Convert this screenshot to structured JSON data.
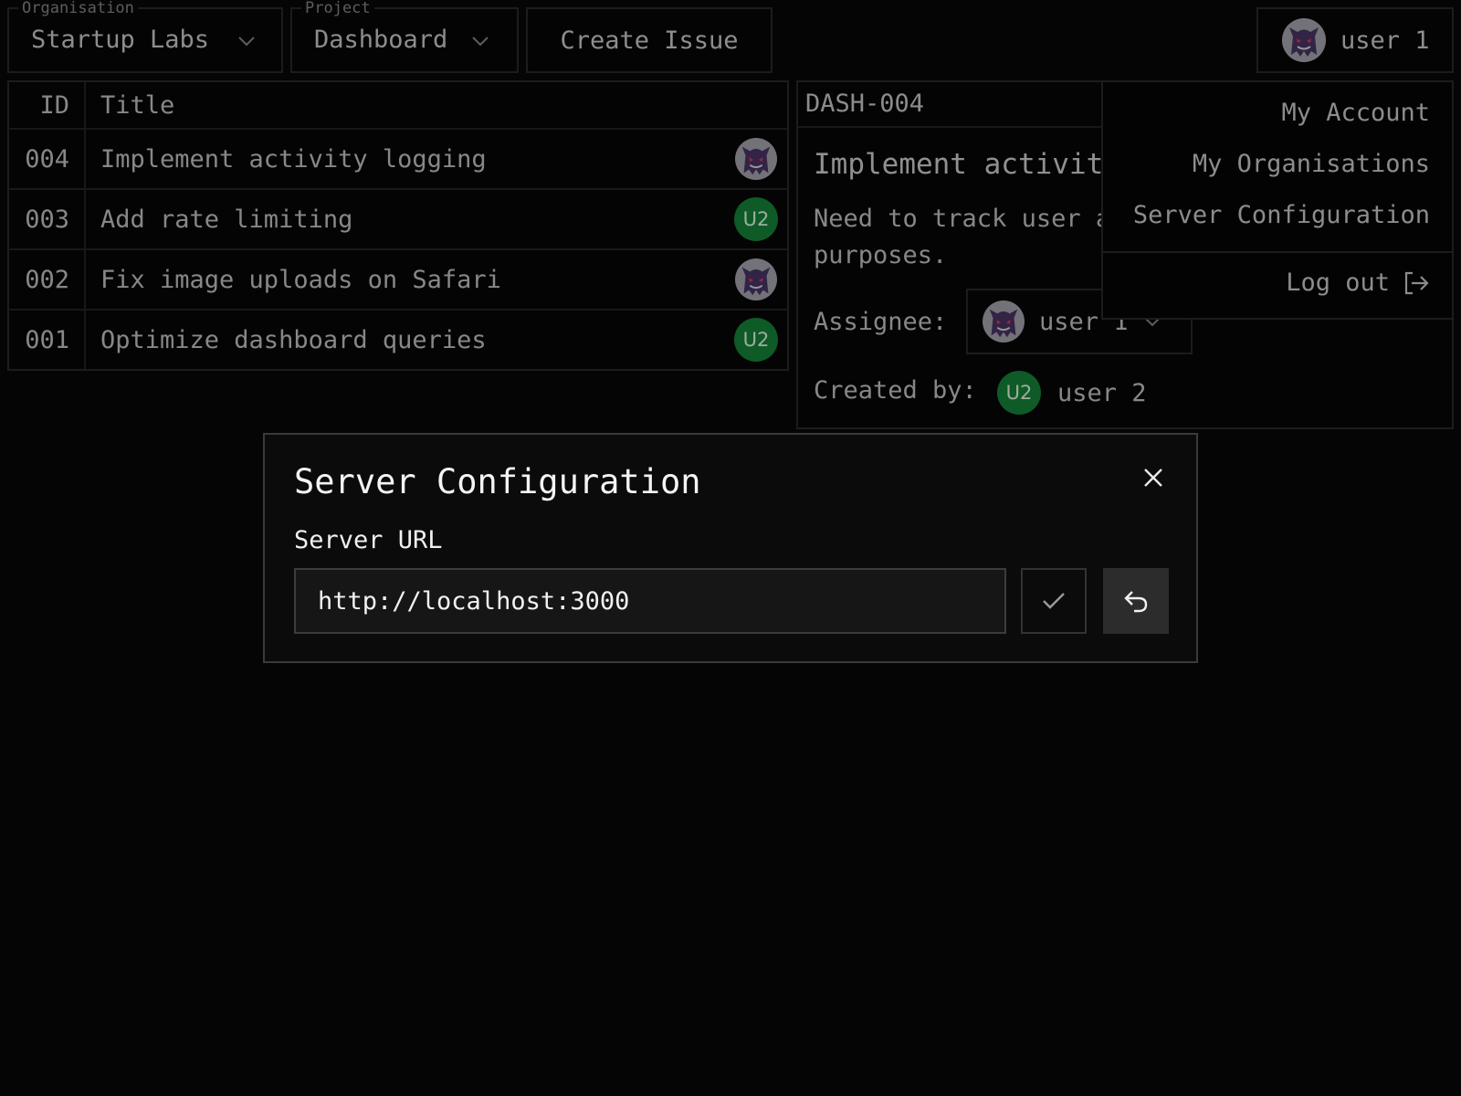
{
  "topbar": {
    "organisation": {
      "legend": "Organisation",
      "value": "Startup Labs"
    },
    "project": {
      "legend": "Project",
      "value": "Dashboard"
    },
    "create_issue_label": "Create Issue",
    "user": {
      "name": "user 1",
      "avatar": "ghost-avatar"
    }
  },
  "issues_table": {
    "columns": [
      "ID",
      "Title"
    ],
    "rows": [
      {
        "id": "004",
        "title": "Implement activity logging",
        "assignee_avatar": "ghost-avatar"
      },
      {
        "id": "003",
        "title": "Add rate limiting",
        "assignee_avatar": "U2"
      },
      {
        "id": "002",
        "title": "Fix image uploads on Safari",
        "assignee_avatar": "ghost-avatar"
      },
      {
        "id": "001",
        "title": "Optimize dashboard queries",
        "assignee_avatar": "U2"
      }
    ]
  },
  "issue_detail": {
    "key": "DASH-004",
    "title": "Implement activity logging",
    "description": "Need to track user actions for audit purposes.",
    "assignee_label": "Assignee:",
    "assignee_name": "user 1",
    "created_by_label": "Created by:",
    "created_by_initials": "U2",
    "created_by_name": "user 2"
  },
  "user_menu": {
    "items": [
      "My Account",
      "My Organisations",
      "Server Configuration"
    ],
    "logout_label": "Log out"
  },
  "server_config_modal": {
    "title": "Server Configuration",
    "field_label": "Server URL",
    "url_value": "http://localhost:3000"
  },
  "colors": {
    "background": "#080808",
    "border": "#2a2a2a",
    "u2_avatar": "#15873a",
    "ghost_avatar_bg": "#a9a9b1"
  }
}
